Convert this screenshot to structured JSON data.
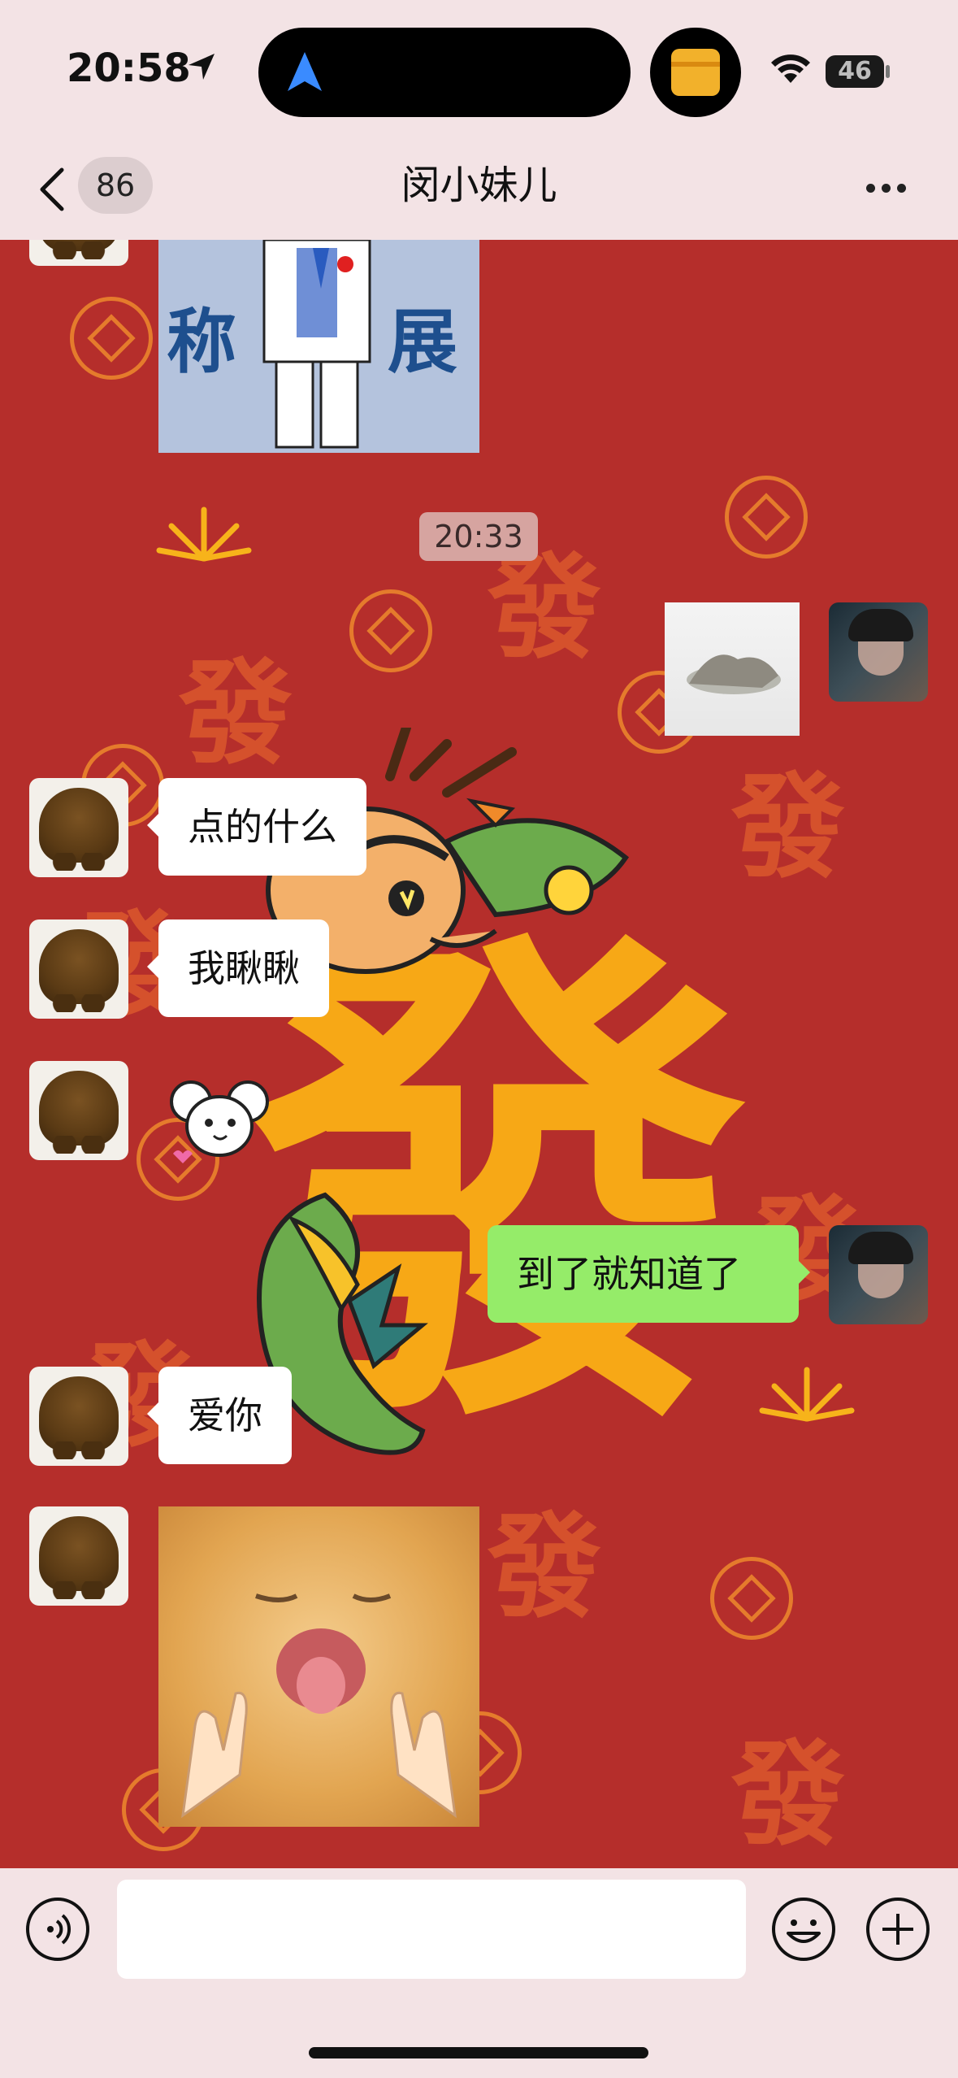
{
  "status_bar": {
    "time": "20:58",
    "battery": "46"
  },
  "nav": {
    "unread_count": "86",
    "title": "闵小妹儿"
  },
  "chat": {
    "background_glyph": "發",
    "top_image_text": [
      "称",
      "展"
    ],
    "timestamp": "20:33",
    "messages": [
      {
        "side": "left",
        "text": "点的什么"
      },
      {
        "side": "left",
        "text": "我瞅瞅"
      },
      {
        "side": "right",
        "text": "到了就知道了"
      },
      {
        "side": "left",
        "text": "爱你"
      }
    ]
  },
  "input": {
    "placeholder": ""
  },
  "colors": {
    "chat_bg": "#b52e2b",
    "out_bubble": "#95ec69",
    "in_bubble": "#ffffff"
  }
}
